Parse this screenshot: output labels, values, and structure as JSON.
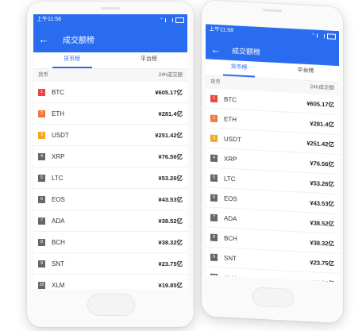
{
  "status": {
    "time": "上午11:58"
  },
  "header": {
    "title": "成交额榜"
  },
  "tabs": [
    {
      "label": "货币榜"
    },
    {
      "label": "平台榜"
    }
  ],
  "columns": {
    "currency": "货币",
    "volume": "24h成交额"
  },
  "rows": [
    {
      "rank": "1",
      "name": "BTC",
      "amount": "¥605.17亿"
    },
    {
      "rank": "2",
      "name": "ETH",
      "amount": "¥281.4亿"
    },
    {
      "rank": "3",
      "name": "USDT",
      "amount": "¥251.42亿"
    },
    {
      "rank": "4",
      "name": "XRP",
      "amount": "¥76.56亿"
    },
    {
      "rank": "5",
      "name": "LTC",
      "amount": "¥53.26亿"
    },
    {
      "rank": "6",
      "name": "EOS",
      "amount": "¥43.53亿"
    },
    {
      "rank": "7",
      "name": "ADA",
      "amount": "¥38.52亿"
    },
    {
      "rank": "8",
      "name": "BCH",
      "amount": "¥38.32亿"
    },
    {
      "rank": "9",
      "name": "SNT",
      "amount": "¥23.75亿"
    },
    {
      "rank": "10",
      "name": "XLM",
      "amount": "¥19.85亿"
    }
  ],
  "icons": {
    "back": "arrow-left-icon",
    "wifi": "wifi-icon",
    "signal": "signal-icon",
    "battery": "battery-icon"
  },
  "colors": {
    "accent": "#2a6cf0",
    "rank1": "#e9453b",
    "rank2": "#f4763a",
    "rank3": "#f5a623",
    "rankOther": "#666666"
  }
}
